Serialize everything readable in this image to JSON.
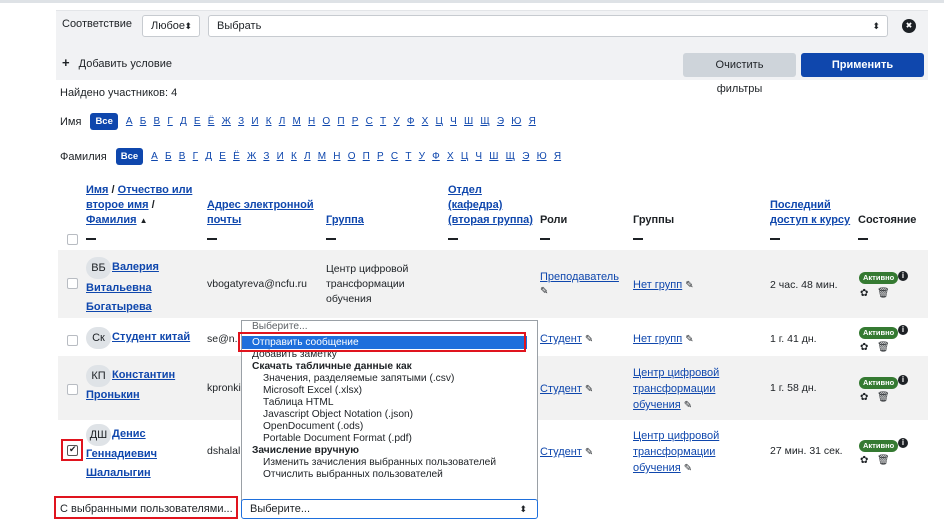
{
  "filter": {
    "condition_label": "Соответствие",
    "match_value": "Любое",
    "select_value": "Выбрать",
    "close_glyph": "✖",
    "add_condition_plus": "+",
    "add_condition_label": "Добавить условие",
    "clear_label": "Очистить фильтры",
    "apply_label": "Применить фильтры"
  },
  "found_label": "Найдено участников: 4",
  "alphabet": {
    "first_label": "Имя",
    "last_label": "Фамилия",
    "all_label": "Все",
    "letters": [
      "А",
      "Б",
      "В",
      "Г",
      "Д",
      "Е",
      "Ё",
      "Ж",
      "З",
      "И",
      "К",
      "Л",
      "М",
      "Н",
      "О",
      "П",
      "Р",
      "С",
      "Т",
      "У",
      "Ф",
      "Х",
      "Ц",
      "Ч",
      "Ш",
      "Щ",
      "Э",
      "Ю",
      "Я"
    ]
  },
  "columns": {
    "name_1": "Имя",
    "name_sep": " / ",
    "name_2": "Отчество или",
    "name_3": "второе имя",
    "name_4": "Фамилия",
    "sort_arrow": "▲",
    "email_1": "Адрес электронной",
    "email_2": "почты",
    "group": "Группа",
    "dept_1": "Отдел",
    "dept_2": "(кафедра)",
    "dept_3": "(вторая группа)",
    "roles": "Роли",
    "groups": "Группы",
    "access_1": "Последний",
    "access_2": "доступ к курсу",
    "status": "Состояние"
  },
  "rows": [
    {
      "initials": "ВБ",
      "name_1": "Валерия",
      "name_2": "Витальевна",
      "name_3": "Богатырева",
      "email": "vbogatyreva@ncfu.ru",
      "group_1": "Центр цифровой",
      "group_2": "трансформации",
      "group_3": "обучения",
      "role": "Преподаватель",
      "groups": "Нет групп",
      "access": "2 час. 48 мин.",
      "status": "Активно"
    },
    {
      "initials": "Ск",
      "name_1": "Студент китай",
      "email": "se@n.i",
      "role": "Студент",
      "groups": "Нет групп",
      "access": "1 г. 41 дн.",
      "status": "Активно"
    },
    {
      "initials": "КП",
      "name_1": "Константин",
      "name_2": "Пронькин",
      "email": "kpronki",
      "role": "Студент",
      "groups_1": "Центр цифровой",
      "groups_2": "трансформации",
      "groups_3": "обучения",
      "access": "1 г. 58 дн.",
      "status": "Активно"
    },
    {
      "initials": "ДШ",
      "name_1": "Денис",
      "name_2": "Геннадиевич",
      "name_3": "Шалалыгин",
      "email": "dshalal",
      "role": "Студент",
      "groups_1": "Центр цифровой",
      "groups_2": "трансформации",
      "groups_3": "обучения",
      "access": "27 мин. 31 сек.",
      "status": "Активно"
    }
  ],
  "icons": {
    "pencil": "✎",
    "gear": "✿",
    "trash": "🗑",
    "info": "i",
    "check": "✔",
    "caret": "◆",
    "updown": "⬍"
  },
  "dropdown": {
    "placeholder": "Выберите...",
    "send_message": "Отправить сообщение",
    "add_note": "Добавить заметку",
    "download_group": "Скачать табличные данные как",
    "csv": "Значения, разделяемые запятыми (.csv)",
    "xlsx": "Microsoft Excel (.xlsx)",
    "html": "Таблица HTML",
    "json": "Javascript Object Notation (.json)",
    "ods": "OpenDocument (.ods)",
    "pdf": "Portable Document Format (.pdf)",
    "enrol_group": "Зачисление вручную",
    "edit_enrol": "Изменить зачисления выбранных пользователей",
    "unenrol": "Отчислить выбранных пользователей"
  },
  "bulk": {
    "label": "С выбранными пользователями...",
    "select_value": "Выберите..."
  },
  "colors": {
    "brand": "#0f47ad",
    "active": "#357a32",
    "highlight": "#e0141e",
    "selected": "#1e6fdc"
  }
}
